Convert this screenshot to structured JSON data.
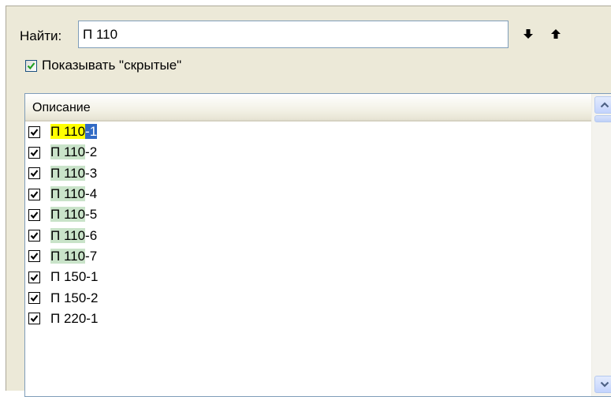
{
  "search": {
    "label": "Найти:",
    "value": "П 110",
    "next_icon": "arrow-down-icon",
    "prev_icon": "arrow-up-icon"
  },
  "show_hidden": {
    "label": "Показывать \"скрытые\"",
    "checked": true
  },
  "list": {
    "column_header": "Описание",
    "rows": [
      {
        "match": "П 110",
        "rest": "-1",
        "checked": true,
        "current": true
      },
      {
        "match": "П 110",
        "rest": "-2",
        "checked": true
      },
      {
        "match": "П 110",
        "rest": "-3",
        "checked": true
      },
      {
        "match": "П 110",
        "rest": "-4",
        "checked": true
      },
      {
        "match": "П 110",
        "rest": "-5",
        "checked": true
      },
      {
        "match": "П 110",
        "rest": "-6",
        "checked": true
      },
      {
        "match": "П 110",
        "rest": "-7",
        "checked": true
      },
      {
        "match": "",
        "rest": "П 150-1",
        "checked": true
      },
      {
        "match": "",
        "rest": "П 150-2",
        "checked": true
      },
      {
        "match": "",
        "rest": "П 220-1",
        "checked": true
      }
    ]
  },
  "colors": {
    "match_highlight": "#c9e3c9",
    "current_match_highlight": "#ffff00",
    "selection": "#316ac5",
    "panel_bg": "#ece9d8"
  }
}
